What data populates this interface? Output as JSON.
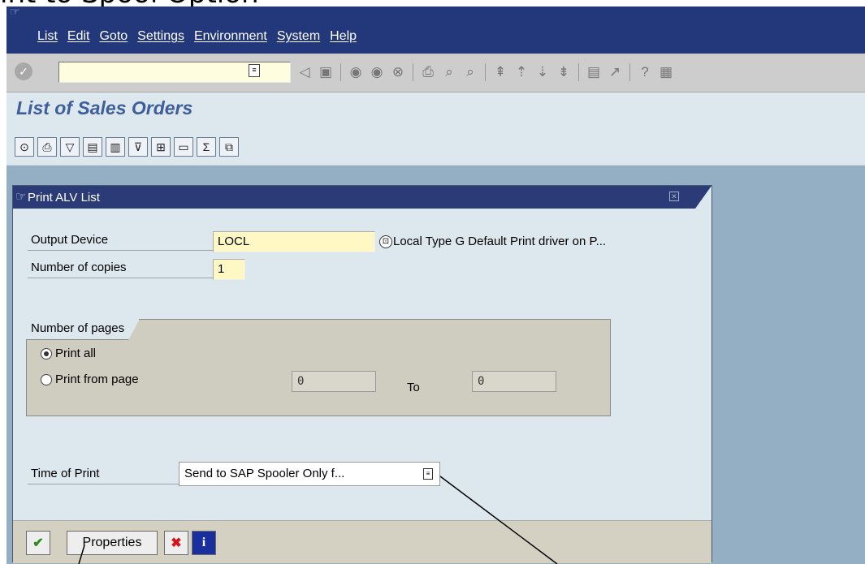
{
  "slide": {
    "title_fragment": "int to Spool Option"
  },
  "menu": [
    "List",
    "Edit",
    "Goto",
    "Settings",
    "Environment",
    "System",
    "Help"
  ],
  "toolbar": {
    "command_field": ""
  },
  "page": {
    "title": "List of Sales Orders"
  },
  "dialog": {
    "title": "Print ALV List",
    "output_device_label": "Output Device",
    "output_device_value": "LOCL",
    "output_device_desc": "Local Type G Default Print driver on P...",
    "copies_label": "Number of copies",
    "copies_value": "1",
    "pages_group_label": "Number of pages",
    "print_all_label": "Print all",
    "print_from_label": "Print from page",
    "from_value": "0",
    "to_label": "To",
    "to_value": "0",
    "print_all_selected": true,
    "time_of_print_label": "Time of Print",
    "time_of_print_value": "Send to SAP Spooler Only f...",
    "properties_label": "Properties"
  },
  "colors": {
    "menubar": "#23377b",
    "title_text": "#3d5e9a",
    "background": "#94afc3",
    "dialog_bg": "#dde7ee"
  }
}
